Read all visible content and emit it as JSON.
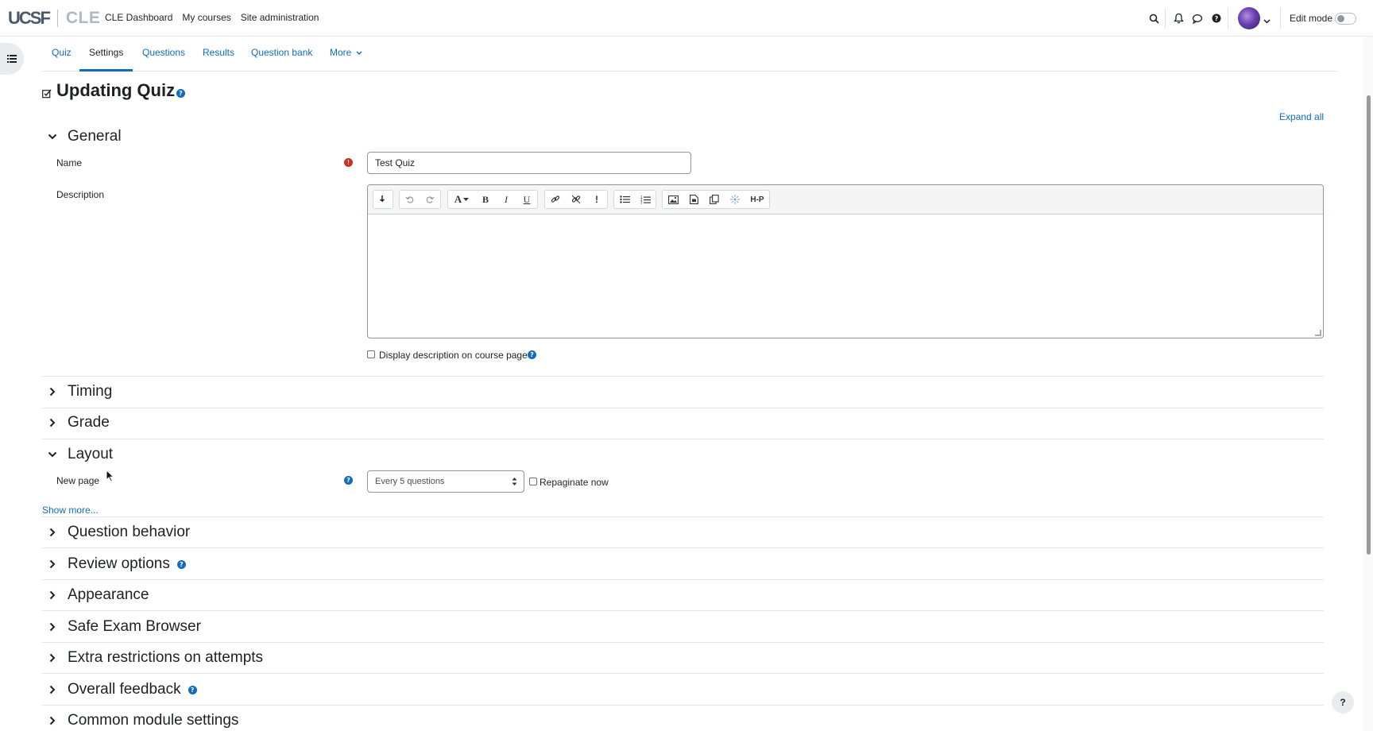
{
  "navbar": {
    "logo_primary": "UCSF",
    "logo_secondary": "CLE",
    "links": [
      "CLE Dashboard",
      "My courses",
      "Site administration"
    ],
    "icons": [
      "search-icon",
      "bell-icon",
      "chat-icon",
      "help-icon"
    ],
    "edit_mode_label": "Edit mode",
    "edit_mode_on": false
  },
  "secondary_nav": {
    "tabs": [
      "Quiz",
      "Settings",
      "Questions",
      "Results",
      "Question bank"
    ],
    "active_tab": "Settings",
    "more_label": "More"
  },
  "page": {
    "title": "Updating Quiz",
    "expand_all": "Expand all"
  },
  "general": {
    "title": "General",
    "name_label": "Name",
    "name_value": "Test Quiz",
    "description_label": "Description",
    "display_description_label": "Display description on course page",
    "toolbar_h5p_label": "H-P"
  },
  "sections": {
    "timing": "Timing",
    "grade": "Grade",
    "layout": "Layout",
    "question_behavior": "Question behavior",
    "review_options": "Review options",
    "appearance": "Appearance",
    "safe_exam_browser": "Safe Exam Browser",
    "extra_restrictions": "Extra restrictions on attempts",
    "overall_feedback": "Overall feedback",
    "common_module_settings": "Common module settings"
  },
  "layout": {
    "new_page_label": "New page",
    "new_page_value": "Every 5 questions",
    "repaginate_label": "Repaginate now",
    "show_more": "Show more..."
  },
  "footer": {
    "help_button": "?"
  },
  "colors": {
    "accent": "#0f6cbf",
    "required": "#ca3120",
    "text": "#1d2125"
  }
}
